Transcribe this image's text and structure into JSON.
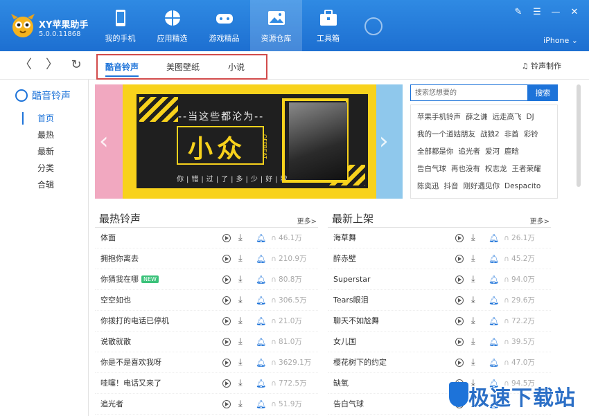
{
  "app": {
    "name": "XY苹果助手",
    "version": "5.0.0.11868",
    "device": "iPhone ⌄"
  },
  "nav": [
    {
      "label": "我的手机",
      "icon": "phone-icon"
    },
    {
      "label": "应用精选",
      "icon": "apps-icon"
    },
    {
      "label": "游戏精品",
      "icon": "gamepad-icon"
    },
    {
      "label": "资源仓库",
      "icon": "image-icon",
      "active": true
    },
    {
      "label": "工具箱",
      "icon": "toolbox-icon"
    }
  ],
  "window": {
    "skin": "✎",
    "menu": "☰",
    "minimize": "—",
    "close": "✕"
  },
  "toolbar": {
    "back": "〈",
    "forward": "〉",
    "refresh": "↻",
    "ringtone_make": "♫ 铃声制作"
  },
  "tabs": [
    {
      "label": "酷音铃声",
      "active": true
    },
    {
      "label": "美图壁纸"
    },
    {
      "label": "小说"
    }
  ],
  "sidebar": {
    "title": "酷音铃声",
    "items": [
      {
        "label": "首页",
        "active": true
      },
      {
        "label": "最热"
      },
      {
        "label": "最新"
      },
      {
        "label": "分类"
      },
      {
        "label": "合辑"
      }
    ]
  },
  "banner": {
    "top_text": "--当这些都沦为--",
    "big_text": "小众",
    "vertical_text": "OFFBEAT",
    "bottom_text": "你|错|过|了|多|少|好|歌",
    "prev": "‹",
    "next": "›"
  },
  "search": {
    "placeholder": "搜索您想要的",
    "button": "搜索"
  },
  "hot_keywords": [
    [
      "苹果手机铃声",
      "薛之谦",
      "远走高飞",
      "DJ"
    ],
    [
      "我的一个道姑朋友",
      "战狼2",
      "非酋",
      "彩铃"
    ],
    [
      "全部都是你",
      "追光者",
      "爱河",
      "鹿晗"
    ],
    [
      "告白气球",
      "再也没有",
      "权志龙",
      "王者荣耀"
    ],
    [
      "陈奕迅",
      "抖音",
      "刚好遇见你",
      "Despacito"
    ]
  ],
  "hot_section": {
    "title": "最热铃声",
    "more": "更多>",
    "rows": [
      {
        "name": "体面",
        "count": "46.1万"
      },
      {
        "name": "拥抱你离去",
        "count": "210.9万"
      },
      {
        "name": "你猜我在哪",
        "count": "80.8万",
        "badge": "NEW"
      },
      {
        "name": "空空如也",
        "count": "306.5万"
      },
      {
        "name": "你拨打的电话已停机",
        "count": "21.0万"
      },
      {
        "name": "说散就散",
        "count": "81.0万"
      },
      {
        "name": "你是不是喜欢我呀",
        "count": "3629.1万"
      },
      {
        "name": "哇噻！电话又来了",
        "count": "772.5万"
      },
      {
        "name": "追光者",
        "count": "51.9万"
      }
    ]
  },
  "new_section": {
    "title": "最新上架",
    "more": "更多>",
    "rows": [
      {
        "name": "海草舞",
        "count": "26.1万"
      },
      {
        "name": "醉赤壁",
        "count": "45.2万"
      },
      {
        "name": "Superstar",
        "count": "94.0万"
      },
      {
        "name": "Tears眼泪",
        "count": "29.6万"
      },
      {
        "name": "聊天不如尬舞",
        "count": "72.2万"
      },
      {
        "name": "女儿国",
        "count": "39.5万"
      },
      {
        "name": "樱花树下的约定",
        "count": "47.0万"
      },
      {
        "name": "缺氧",
        "count": "94.5万"
      },
      {
        "name": "告白气球",
        "count": ""
      }
    ]
  },
  "watermark": "极速下载站"
}
